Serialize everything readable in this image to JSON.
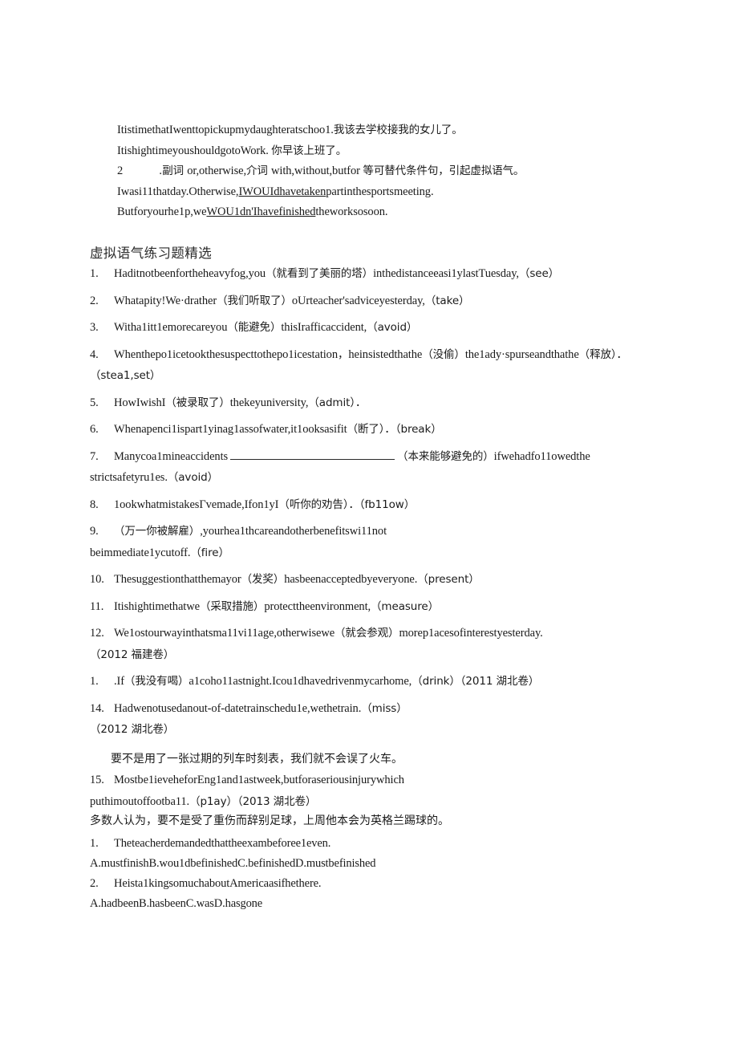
{
  "document": {
    "intro_block": {
      "lines": [
        {
          "id": "intro-line-1",
          "segments": [
            {
              "t": "en",
              "text": "ItistimethatIwenttopickupmydaughteratschoo1."
            },
            {
              "t": "cn",
              "text": "我该去学校接我的女儿了。"
            }
          ]
        },
        {
          "id": "intro-line-2",
          "segments": [
            {
              "t": "en",
              "text": "ItishightimeyoushouldgotoWork. "
            },
            {
              "t": "cn",
              "text": "你早该上班了。"
            }
          ]
        },
        {
          "id": "intro-line-3-rule",
          "marker": "2",
          "segments": [
            {
              "t": "cn",
              "text": ".副词 "
            },
            {
              "t": "en",
              "text": "or,otherwise,"
            },
            {
              "t": "cn",
              "text": "介词 "
            },
            {
              "t": "en",
              "text": "with,without,butfor "
            },
            {
              "t": "cn",
              "text": "等可替代条件句，引起虚拟语气。"
            }
          ]
        },
        {
          "id": "intro-line-4",
          "segments": [
            {
              "t": "en",
              "text": "Iwasi11thatday.Otherwise,"
            },
            {
              "t": "u",
              "text": "IWOUIdhavetaken"
            },
            {
              "t": "en",
              "text": "partinthesportsmeeting."
            }
          ]
        },
        {
          "id": "intro-line-5",
          "segments": [
            {
              "t": "en",
              "text": "Butforyourhe1p,we"
            },
            {
              "t": "u",
              "text": "WOU1dn'Ihavefinished"
            },
            {
              "t": "en",
              "text": "theworksosoon."
            }
          ]
        }
      ]
    },
    "section_heading": "虚拟语气练习题精选",
    "exercises": [
      {
        "num": "1.",
        "parts": [
          {
            "t": "en",
            "text": "Haditnotbeenfortheheavyfog,you"
          },
          {
            "t": "cn",
            "text": "（就看到了美丽的塔）"
          },
          {
            "t": "en",
            "text": "inthedistanceeasi1ylastTuesday,"
          },
          {
            "t": "cn",
            "text": "（see）"
          }
        ]
      },
      {
        "num": "2.",
        "parts": [
          {
            "t": "en",
            "text": "Whatapity!We·drather"
          },
          {
            "t": "cn",
            "text": "（我们听取了）"
          },
          {
            "t": "en",
            "text": "oUrteacher'sadviceyesterday,"
          },
          {
            "t": "cn",
            "text": "（take）"
          }
        ]
      },
      {
        "num": "3.",
        "parts": [
          {
            "t": "en",
            "text": "Witha1itt1emorecareyou"
          },
          {
            "t": "cn",
            "text": "（能避免）"
          },
          {
            "t": "en",
            "text": "thisIrafficaccident,"
          },
          {
            "t": "cn",
            "text": "（avoid）"
          }
        ]
      },
      {
        "num": "4.",
        "parts": [
          {
            "t": "en",
            "text": "Whenthepo1icetookthesuspecttothepo1icestation"
          },
          {
            "t": "cn",
            "text": "，"
          },
          {
            "t": "en",
            "text": "heinsistedthathe"
          },
          {
            "t": "cn",
            "text": "（没偷）"
          },
          {
            "t": "en",
            "text": "the1ady·spurseandthathe"
          },
          {
            "t": "cn",
            "text": "（释放）．（stea1,set）"
          }
        ]
      },
      {
        "num": "5.",
        "parts": [
          {
            "t": "en",
            "text": "HowIwishI"
          },
          {
            "t": "cn",
            "text": "（被录取了）"
          },
          {
            "t": "en",
            "text": "thekeyuniversity,"
          },
          {
            "t": "cn",
            "text": "（admit）．"
          }
        ]
      },
      {
        "num": "6.",
        "parts": [
          {
            "t": "en",
            "text": "Whenapenci1ispart1yinag1assofwater,it1ooksasifit"
          },
          {
            "t": "cn",
            "text": "（断了）．（break）"
          }
        ]
      },
      {
        "num": "7.",
        "parts": [
          {
            "t": "en",
            "text": "Manycoa1mineaccidents"
          },
          {
            "t": "blank",
            "text": ""
          },
          {
            "t": "cn",
            "text": "（本来能够避免的）"
          },
          {
            "t": "en",
            "text": "ifwehadfo11owedthe"
          },
          {
            "t": "br",
            "text": ""
          },
          {
            "t": "en",
            "text": "strictsafetyru1es."
          },
          {
            "t": "cn",
            "text": "（avoid）"
          }
        ]
      },
      {
        "num": "8.",
        "parts": [
          {
            "t": "en",
            "text": "1ookwhatmistakesΓvemade,Ifon1yI"
          },
          {
            "t": "cn",
            "text": "（听你的劝告）．（fb11ow）"
          }
        ]
      },
      {
        "num": "9.",
        "parts": [
          {
            "t": "cn",
            "text": "（万一你被解雇）"
          },
          {
            "t": "en",
            "text": ",yourhea1thcareandotherbenefitswi11not"
          },
          {
            "t": "br",
            "text": ""
          },
          {
            "t": "en",
            "text": "beimmediate1ycutoff."
          },
          {
            "t": "cn",
            "text": "（fire）"
          }
        ]
      },
      {
        "num": "10.",
        "parts": [
          {
            "t": "en",
            "text": "Thesuggestionthatthemayor"
          },
          {
            "t": "cn",
            "text": "（发奖）"
          },
          {
            "t": "en",
            "text": "hasbeenacceptedbyeveryone."
          },
          {
            "t": "cn",
            "text": "（present）"
          }
        ]
      },
      {
        "num": "11.",
        "parts": [
          {
            "t": "en",
            "text": "Itishightimethatwe"
          },
          {
            "t": "cn",
            "text": "（采取措施）"
          },
          {
            "t": "en",
            "text": "protecttheenvironment,"
          },
          {
            "t": "cn",
            "text": "（measure）"
          }
        ]
      },
      {
        "num": "12.",
        "parts": [
          {
            "t": "en",
            "text": "We1ostourwayinthatsma11vi11age,otherwisewe"
          },
          {
            "t": "cn",
            "text": "（就会参观）"
          },
          {
            "t": "en",
            "text": "morep1acesofinterestyesterday."
          },
          {
            "t": "br",
            "text": ""
          },
          {
            "t": "cn",
            "text": "（2012 福建卷）"
          }
        ]
      },
      {
        "num": "1.",
        "parts": [
          {
            "t": "en",
            "text": ".If"
          },
          {
            "t": "cn",
            "text": "（我没有喝）"
          },
          {
            "t": "en",
            "text": "a1coho11astnight.Icou1dhavedrivenmycarhome,"
          },
          {
            "t": "cn",
            "text": "（drink）（2011 湖北卷）"
          }
        ]
      },
      {
        "num": "14.",
        "parts": [
          {
            "t": "en",
            "text": "Hadwenotusedanout-of-datetrainschedu1e,wethetrain."
          },
          {
            "t": "cn",
            "text": "（miss）"
          },
          {
            "t": "br",
            "text": ""
          },
          {
            "t": "cn",
            "text": "（2012 湖北卷）"
          }
        ]
      }
    ],
    "translation_note_1": "要不是用了一张过期的列车时刻表，我们就不会误了火车。",
    "exercise_15": {
      "num": "15.",
      "parts": [
        {
          "t": "en",
          "text": "Mostbe1ieveheforEng1and1astweek,butforaseriousinjurywhich"
        },
        {
          "t": "br",
          "text": ""
        },
        {
          "t": "en",
          "text": "puthimoutoffootba11."
        },
        {
          "t": "cn",
          "text": "（p1ay）（2013 湖北卷）"
        }
      ]
    },
    "translation_note_2": "多数人认为，要不是受了重伤而辞别足球，上周他本会为英格兰踢球的。",
    "multiple_choice": [
      {
        "num": "1.",
        "stem": "Theteacherdemandedthattheexambeforee1even.",
        "options": "A.mustfinishB.wou1dbefinishedC.befinishedD.mustbefinished"
      },
      {
        "num": "2.",
        "stem": "Heista1kingsomuchaboutAmericaasifhethere.",
        "options": "A.hadbeenB.hasbeenC.wasD.hasgone"
      }
    ]
  },
  "colors": {
    "text": "#1a1a1a",
    "heading": "#2b2b2b",
    "background": "#ffffff",
    "rule": "#2a2a2a"
  }
}
